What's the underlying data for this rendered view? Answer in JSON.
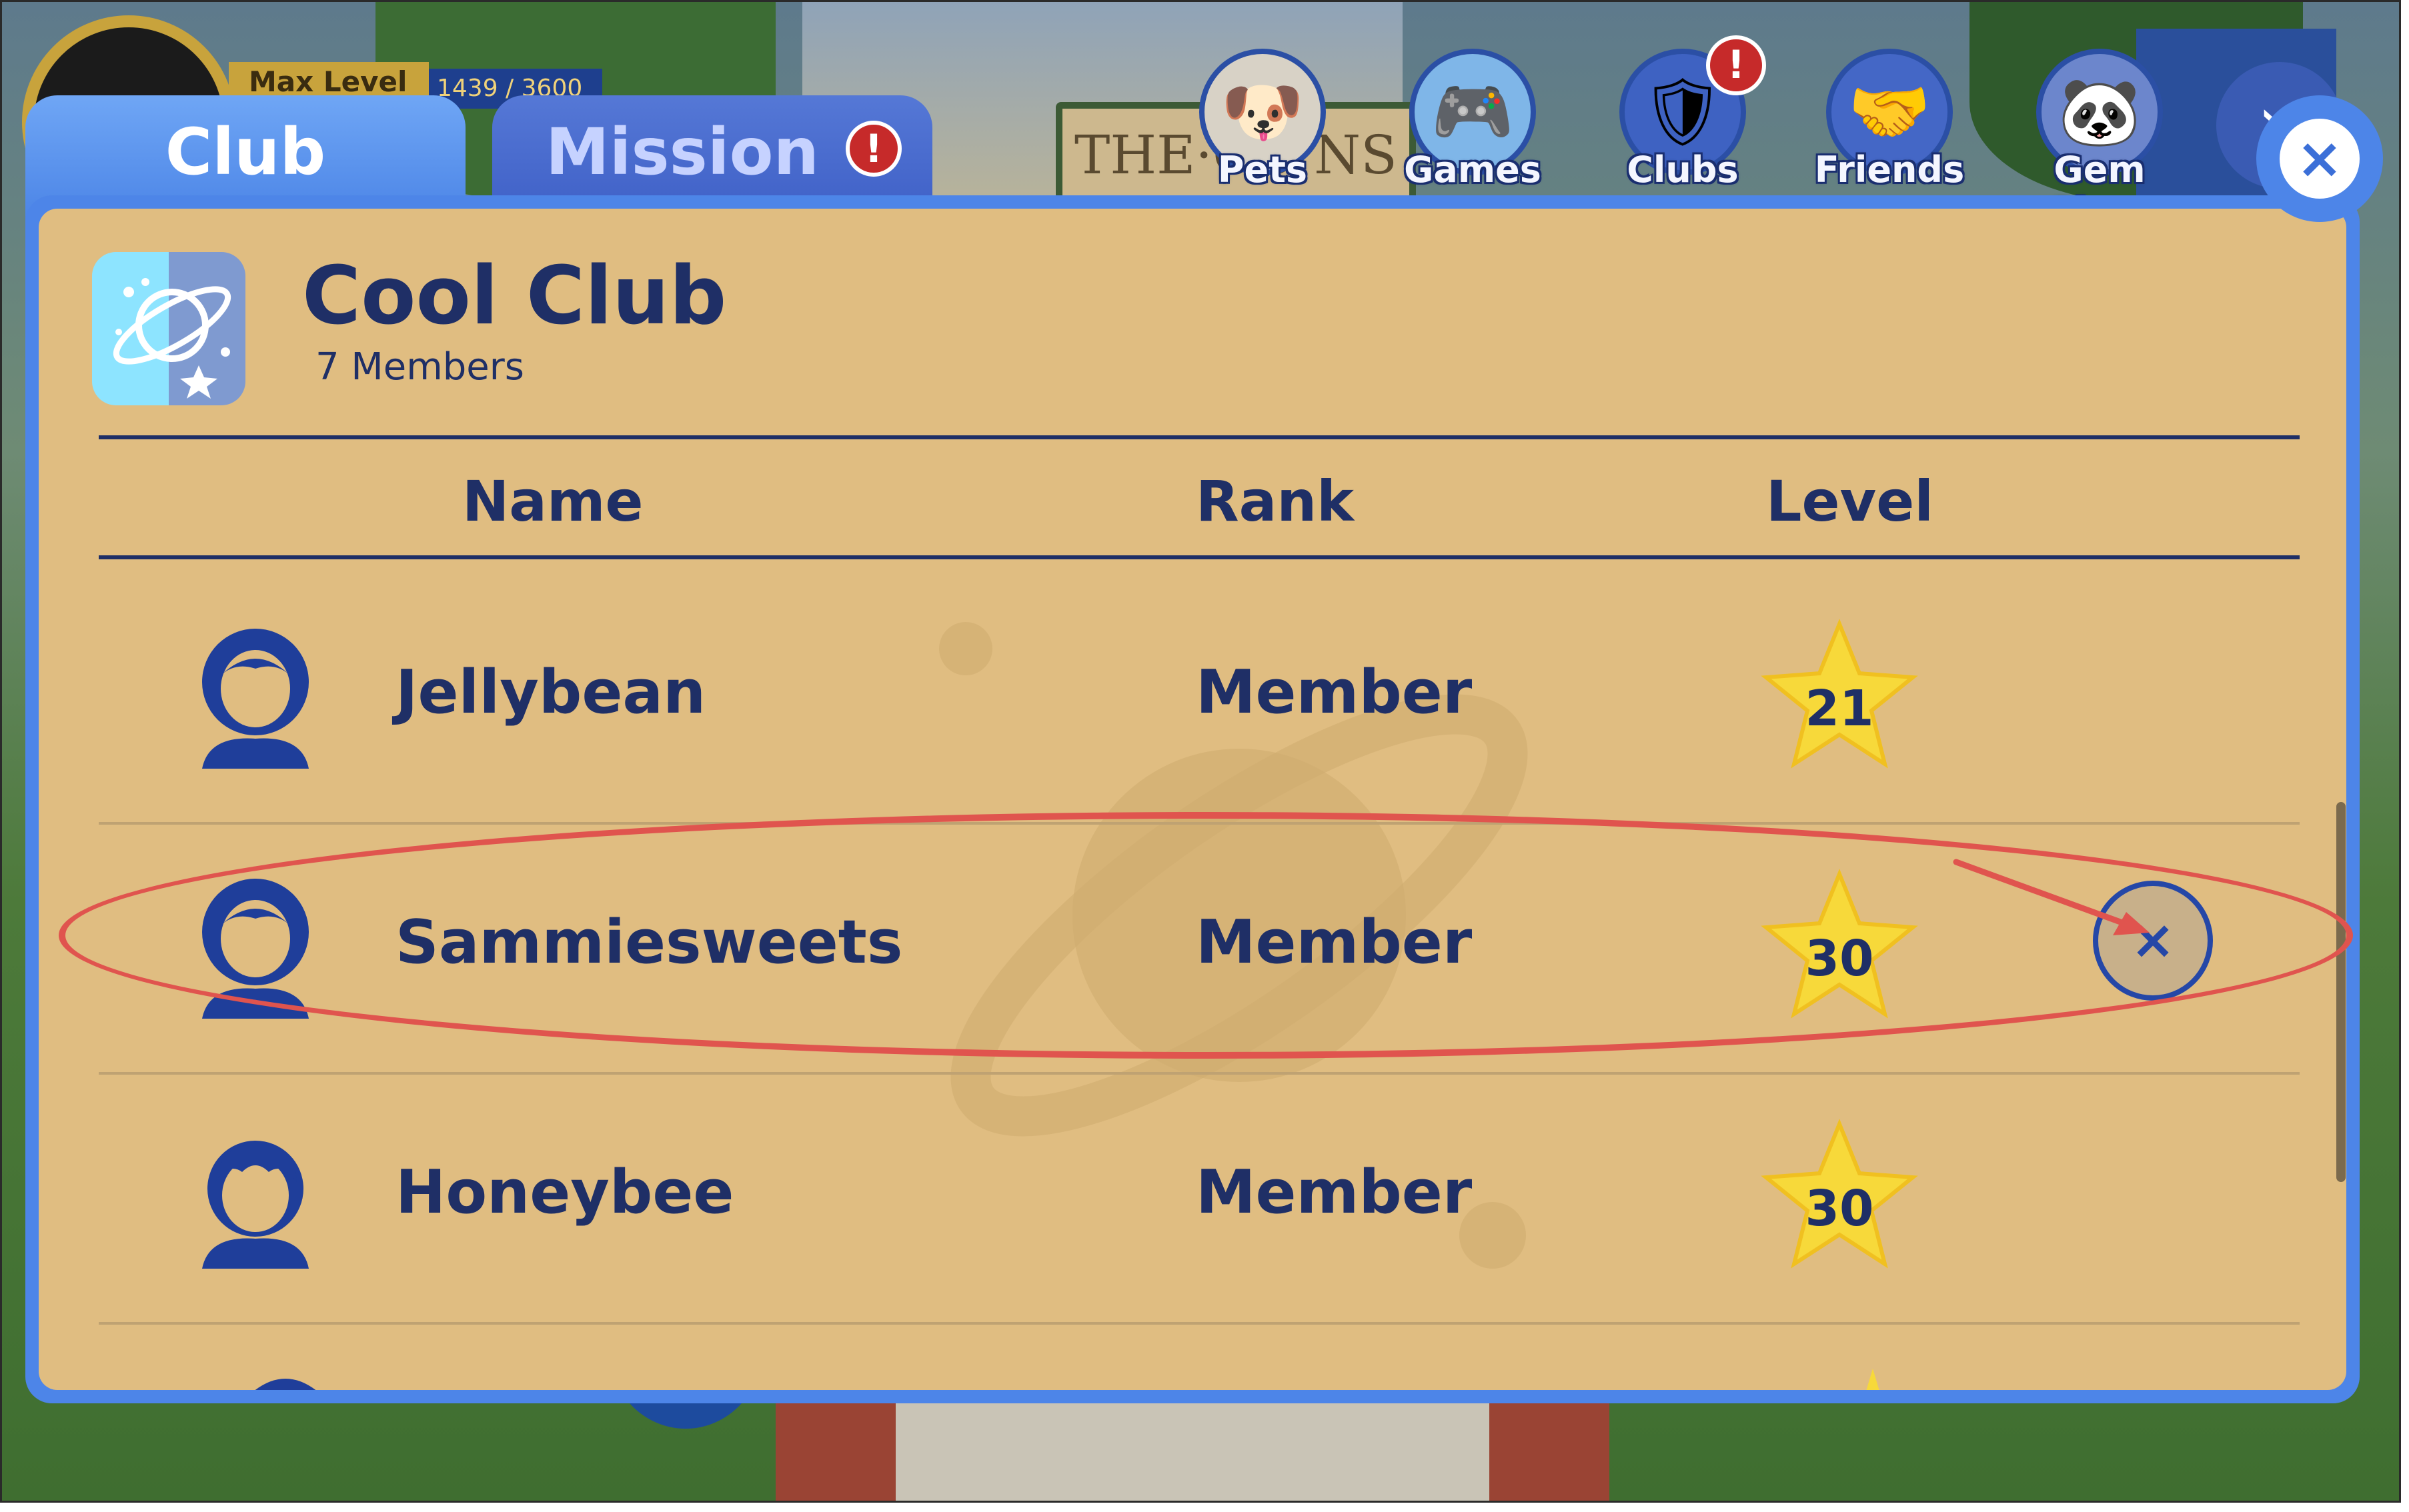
{
  "hud": {
    "level_label": "Max Level",
    "xp": "1439 / 3600"
  },
  "background": {
    "sign_text": "THE·CO     NS"
  },
  "nav": [
    {
      "label": "Pets",
      "icon": "dog-icon"
    },
    {
      "label": "Games",
      "icon": "gamepad-icon"
    },
    {
      "label": "Clubs",
      "icon": "clubs-shield-icon",
      "badge": "!"
    },
    {
      "label": "Friends",
      "icon": "handshake-icon"
    },
    {
      "label": "Gem Shop",
      "icon": "panda-icon"
    }
  ],
  "tabs": {
    "club": "Club",
    "mission": "Mission",
    "mission_badge": "!"
  },
  "club": {
    "name": "Cool Club",
    "members_text": "7 Members"
  },
  "table": {
    "headers": {
      "name": "Name",
      "rank": "Rank",
      "level": "Level"
    },
    "rows": [
      {
        "name": "Jellybean",
        "rank": "Member",
        "level": "21",
        "avatar": "girl-avatar-icon"
      },
      {
        "name": "Sammiesweets",
        "rank": "Member",
        "level": "30",
        "avatar": "girl-avatar-icon",
        "action": "×"
      },
      {
        "name": "Honeybee",
        "rank": "Member",
        "level": "30",
        "avatar": "boy-avatar-icon"
      }
    ]
  },
  "close_glyph": "×",
  "colors": {
    "panel": "#e0bd81",
    "text": "#1f2f66",
    "modal_border": "#4d85e8",
    "highlight": "#e0544e",
    "star": "#f7d93a"
  }
}
